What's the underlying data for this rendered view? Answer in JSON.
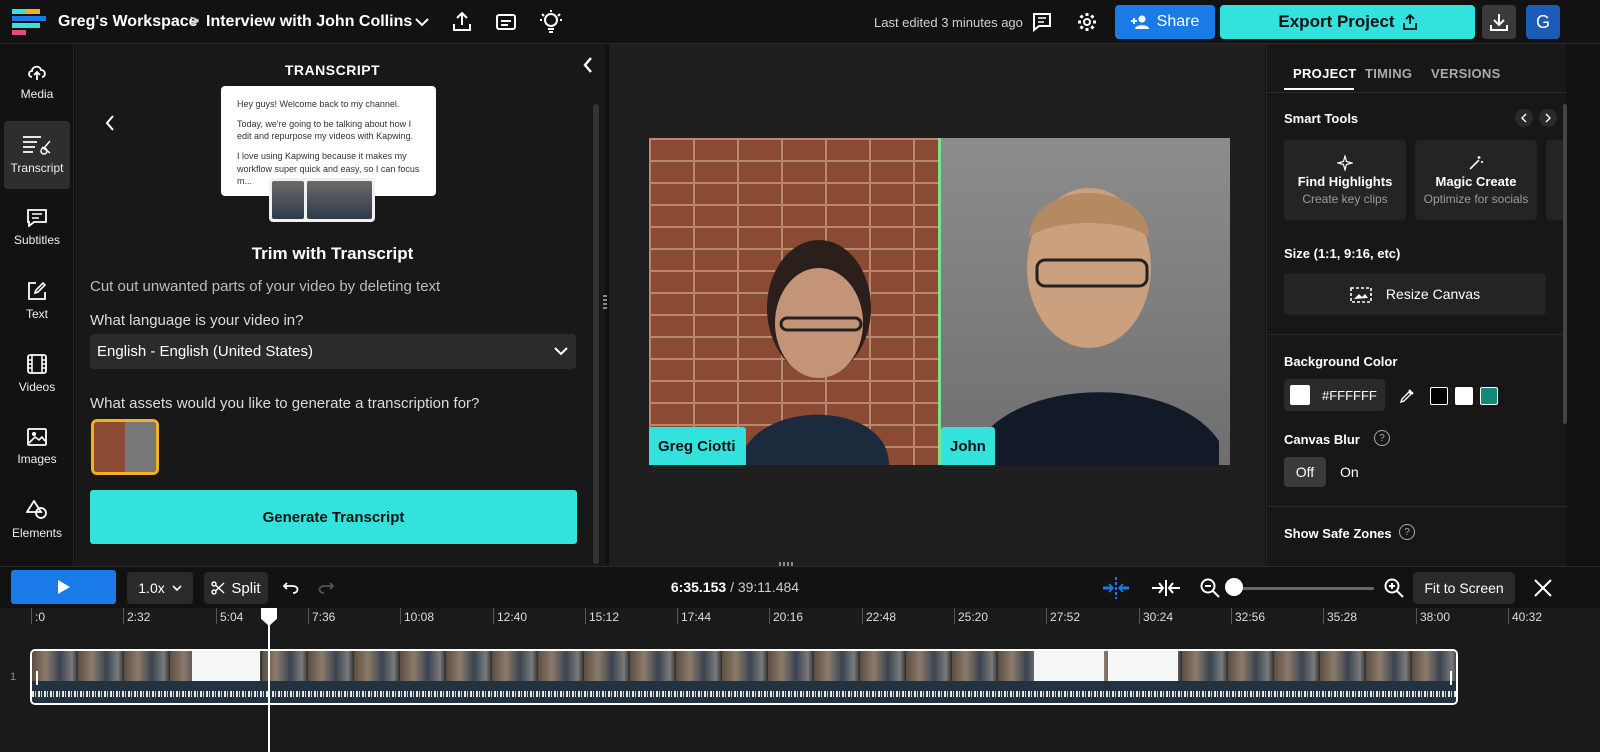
{
  "header": {
    "workspace": "Greg's Workspace",
    "separator": ">",
    "project_title": "Interview with John Collins",
    "last_edited": "Last edited 3 minutes ago",
    "share_label": "Share",
    "export_label": "Export Project",
    "avatar_letter": "G"
  },
  "left_nav": {
    "items": [
      {
        "label": "Media",
        "icon": "upload-cloud-icon"
      },
      {
        "label": "Transcript",
        "icon": "transcript-icon"
      },
      {
        "label": "Subtitles",
        "icon": "subtitles-icon"
      },
      {
        "label": "Text",
        "icon": "text-edit-icon"
      },
      {
        "label": "Videos",
        "icon": "film-icon"
      },
      {
        "label": "Images",
        "icon": "image-icon"
      },
      {
        "label": "Elements",
        "icon": "shapes-icon"
      }
    ],
    "active": "Transcript"
  },
  "transcript_panel": {
    "title": "TRANSCRIPT",
    "preview_lines": [
      "Hey guys! Welcome back to my channel.",
      "Today, we're going to be talking about how I edit and repurpose my videos with Kapwing.",
      "I love using Kapwing because it makes my workflow super quick and easy, so I can focus m..."
    ],
    "heading": "Trim with Transcript",
    "description": "Cut out unwanted parts of your video by deleting text",
    "language_question": "What language is your video in?",
    "language_value": "English - English (United States)",
    "assets_question": "What assets would you like to generate a transcription for?",
    "generate_label": "Generate Transcript"
  },
  "video": {
    "left_name": "Greg Ciotti",
    "right_name": "John"
  },
  "right_panel": {
    "tabs": [
      "PROJECT",
      "TIMING",
      "VERSIONS"
    ],
    "active_tab": "PROJECT",
    "smart_tools_label": "Smart Tools",
    "tools": [
      {
        "title": "Find Highlights",
        "subtitle": "Create key clips"
      },
      {
        "title": "Magic Create",
        "subtitle": "Optimize for socials"
      }
    ],
    "size_label": "Size (1:1, 9:16, etc)",
    "resize_label": "Resize Canvas",
    "bg_color_label": "Background Color",
    "bg_color_value": "#FFFFFF",
    "swatches": [
      "#000000",
      "#FFFFFF",
      "#13897A"
    ],
    "canvas_blur_label": "Canvas Blur",
    "blur_off": "Off",
    "blur_on": "On",
    "safe_zones_label": "Show Safe Zones"
  },
  "timeline_toolbar": {
    "speed": "1.0x",
    "split_label": "Split",
    "current_time": "6:35.153",
    "time_separator": "/",
    "total_time": "39:11.484",
    "fit_label": "Fit to Screen"
  },
  "timeline": {
    "ruler": [
      ":0",
      "2:32",
      "5:04",
      "7:36",
      "10:08",
      "12:40",
      "15:12",
      "17:44",
      "20:16",
      "22:48",
      "25:20",
      "27:52",
      "30:24",
      "32:56",
      "35:28",
      "38:00",
      "40:32"
    ],
    "track_number": "1"
  },
  "colors": {
    "accent_teal": "#33E2DC",
    "accent_blue": "#1A7AE8",
    "highlight_yellow": "#F2B11F"
  }
}
